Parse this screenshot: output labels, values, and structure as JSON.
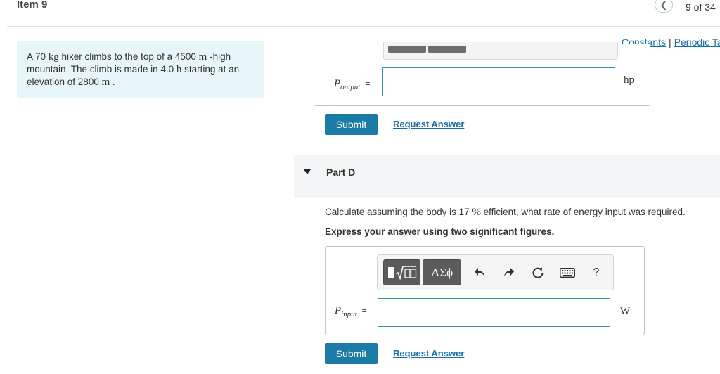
{
  "header": {
    "item_title": "Item 9",
    "prev_icon": "chevron-left-icon",
    "position": "9 of 34"
  },
  "problem": {
    "p1": "A 70 ",
    "u_kg": "kg",
    "p2": " hiker climbs to the top of a 4500 ",
    "u_m1": "m",
    "p3": " -high mountain. The climb is made in 4.0 ",
    "u_h": "h",
    "p4": " starting at an elevation of 2800 ",
    "u_m2": "m",
    "p5": " ."
  },
  "links": {
    "constants": "Constants",
    "separator": "|",
    "periodic_table": "Periodic Ta"
  },
  "part_c": {
    "variable": "P",
    "subscript": "output",
    "equals": "=",
    "input_value": "",
    "unit": "hp",
    "submit_label": "Submit",
    "request_label": "Request Answer"
  },
  "part_d": {
    "title": "Part D",
    "q1": "Calculate assuming the body is 17 ",
    "q_unit": "%",
    "q2": " efficient, what rate of energy input was required.",
    "instruction": "Express your answer using two significant figures.",
    "toolbar": {
      "templates_icon": "templates-sqrt-icon",
      "symbols_label": "ΑΣϕ",
      "undo_icon": "undo-icon",
      "redo_icon": "redo-icon",
      "reset_icon": "reset-icon",
      "keyboard_icon": "keyboard-icon",
      "help_label": "?"
    },
    "variable": "P",
    "subscript": "input",
    "equals": "=",
    "input_value": "",
    "unit": "W",
    "submit_label": "Submit",
    "request_label": "Request Answer"
  },
  "colors": {
    "accent": "#1a7ba6",
    "link": "#1b6fa8",
    "problem_bg": "#e9f6f8",
    "input_border": "#3a8fb0"
  }
}
